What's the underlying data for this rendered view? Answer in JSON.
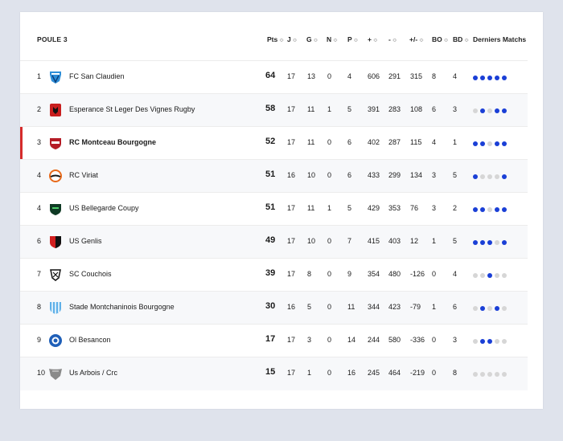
{
  "pool_title": "POULE 3",
  "columns": [
    {
      "key": "pts",
      "label": "Pts"
    },
    {
      "key": "j",
      "label": "J"
    },
    {
      "key": "g",
      "label": "G"
    },
    {
      "key": "n",
      "label": "N"
    },
    {
      "key": "p",
      "label": "P"
    },
    {
      "key": "plus",
      "label": "+"
    },
    {
      "key": "minus",
      "label": "-"
    },
    {
      "key": "diff",
      "label": "+/-"
    },
    {
      "key": "bo",
      "label": "BO"
    },
    {
      "key": "bd",
      "label": "BD"
    },
    {
      "key": "form",
      "label": "Derniers Matchs"
    }
  ],
  "sort_glyph": "≎",
  "colors": {
    "highlight": "#d52b2b",
    "win": "#1a3fd6",
    "other": "#d6d6d6"
  },
  "teams": [
    {
      "rank": "1",
      "name": "FC San Claudien",
      "logo": "crest-blue-icon",
      "pts": "64",
      "j": "17",
      "g": "13",
      "n": "0",
      "p": "4",
      "plus": "606",
      "minus": "291",
      "diff": "315",
      "bo": "8",
      "bd": "4",
      "form": [
        "W",
        "W",
        "W",
        "W",
        "W"
      ]
    },
    {
      "rank": "2",
      "name": "Esperance St Leger Des Vignes Rugby",
      "logo": "red-crest-icon",
      "pts": "58",
      "j": "17",
      "g": "11",
      "n": "1",
      "p": "5",
      "plus": "391",
      "minus": "283",
      "diff": "108",
      "bo": "6",
      "bd": "3",
      "form": [
        "O",
        "W",
        "O",
        "W",
        "W"
      ]
    },
    {
      "rank": "3",
      "name": "RC Montceau Bourgogne",
      "logo": "red-shield-icon",
      "pts": "52",
      "j": "17",
      "g": "11",
      "n": "0",
      "p": "6",
      "plus": "402",
      "minus": "287",
      "diff": "115",
      "bo": "4",
      "bd": "1",
      "form": [
        "W",
        "W",
        "O",
        "W",
        "W"
      ],
      "highlight": true
    },
    {
      "rank": "4",
      "name": "RC Viriat",
      "logo": "orange-swirl-icon",
      "pts": "51",
      "j": "16",
      "g": "10",
      "n": "0",
      "p": "6",
      "plus": "433",
      "minus": "299",
      "diff": "134",
      "bo": "3",
      "bd": "5",
      "form": [
        "W",
        "O",
        "O",
        "O",
        "W"
      ]
    },
    {
      "rank": "4",
      "name": "US Bellegarde Coupy",
      "logo": "green-shield-icon",
      "pts": "51",
      "j": "17",
      "g": "11",
      "n": "1",
      "p": "5",
      "plus": "429",
      "minus": "353",
      "diff": "76",
      "bo": "3",
      "bd": "2",
      "form": [
        "W",
        "W",
        "O",
        "W",
        "W"
      ]
    },
    {
      "rank": "6",
      "name": "US Genlis",
      "logo": "red-black-shield-icon",
      "pts": "49",
      "j": "17",
      "g": "10",
      "n": "0",
      "p": "7",
      "plus": "415",
      "minus": "403",
      "diff": "12",
      "bo": "1",
      "bd": "5",
      "form": [
        "W",
        "W",
        "W",
        "O",
        "W"
      ]
    },
    {
      "rank": "7",
      "name": "SC Couchois",
      "logo": "black-crest-icon",
      "pts": "39",
      "j": "17",
      "g": "8",
      "n": "0",
      "p": "9",
      "plus": "354",
      "minus": "480",
      "diff": "-126",
      "bo": "0",
      "bd": "4",
      "form": [
        "O",
        "O",
        "W",
        "O",
        "O"
      ]
    },
    {
      "rank": "8",
      "name": "Stade Montchaninois Bourgogne",
      "logo": "blue-white-shield-icon",
      "pts": "30",
      "j": "16",
      "g": "5",
      "n": "0",
      "p": "11",
      "plus": "344",
      "minus": "423",
      "diff": "-79",
      "bo": "1",
      "bd": "6",
      "form": [
        "O",
        "W",
        "O",
        "W",
        "O"
      ]
    },
    {
      "rank": "9",
      "name": "Ol Besancon",
      "logo": "blue-round-icon",
      "pts": "17",
      "j": "17",
      "g": "3",
      "n": "0",
      "p": "14",
      "plus": "244",
      "minus": "580",
      "diff": "-336",
      "bo": "0",
      "bd": "3",
      "form": [
        "O",
        "W",
        "W",
        "O",
        "O"
      ]
    },
    {
      "rank": "10",
      "name": "Us Arbois / Crc",
      "logo": "grey-shield-icon",
      "pts": "15",
      "j": "17",
      "g": "1",
      "n": "0",
      "p": "16",
      "plus": "245",
      "minus": "464",
      "diff": "-219",
      "bo": "0",
      "bd": "8",
      "form": [
        "O",
        "O",
        "O",
        "O",
        "O"
      ]
    }
  ]
}
